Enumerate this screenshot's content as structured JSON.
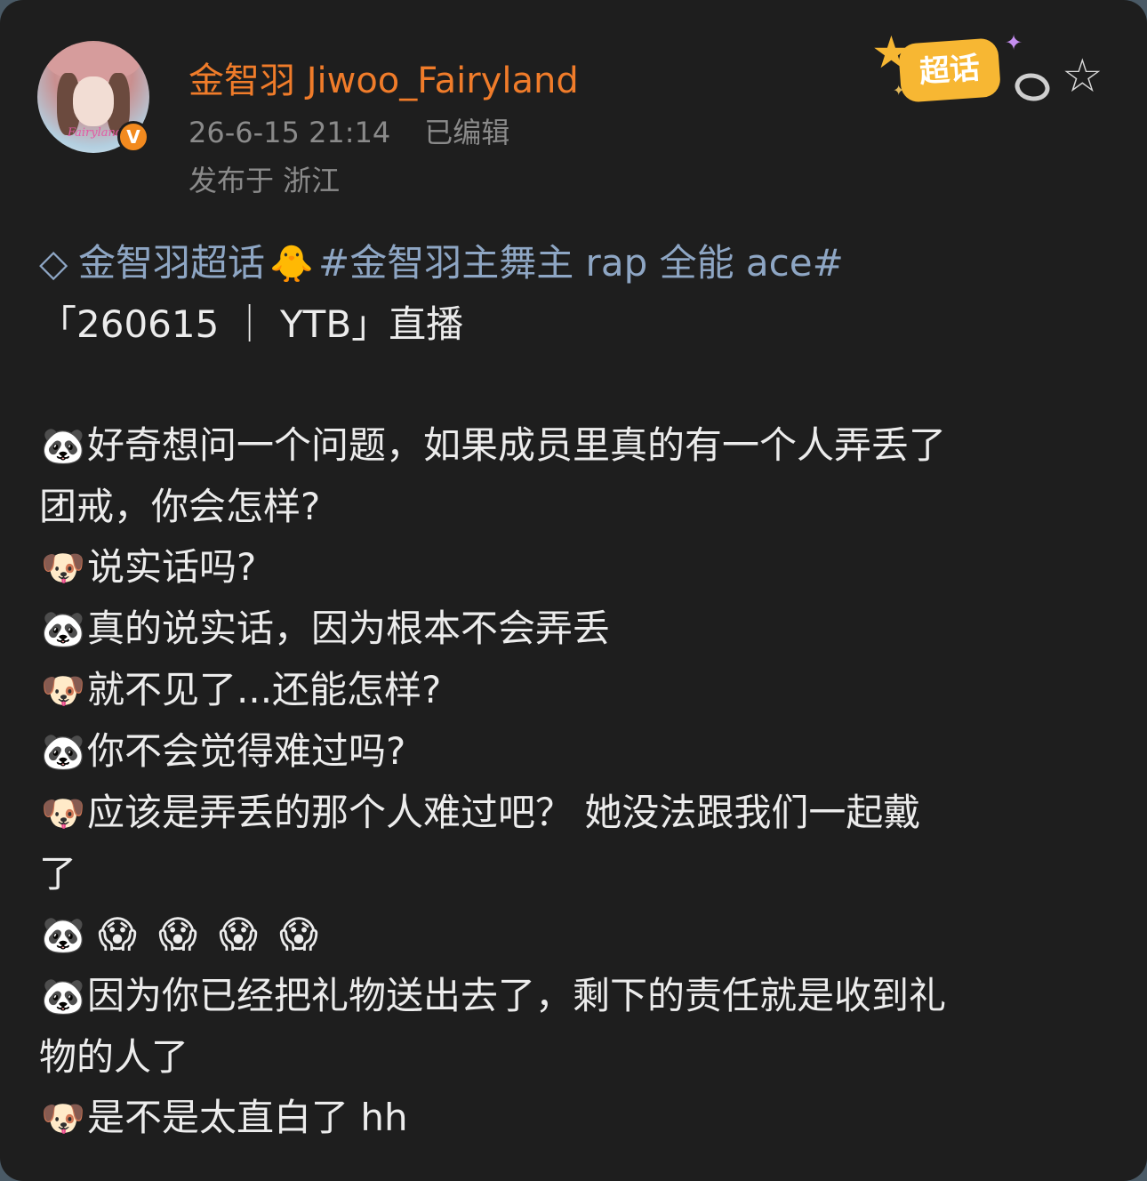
{
  "user": {
    "name": "金智羽 Jiwoo_Fairyland",
    "avatar_text": "Fairyland",
    "verified_badge": "V",
    "timestamp": "26-6-15 21:14",
    "edited": "已编辑",
    "location": "发布于 浙江"
  },
  "actions": {
    "supertopic_label": "超话",
    "favorite_icon": "star-icon",
    "supertopic_icon": "supertopic-icon"
  },
  "post": {
    "supertopic": "金智羽超话",
    "hashtag": "#金智羽主舞主 rap 全能 ace#",
    "header": "「260615 ｜ YTB」直播",
    "lines": [
      "好奇想问一个问题，如果成员里真的有一个人弄丢了",
      "团戒，你会怎样?",
      "说实话吗?",
      "真的说实话，因为根本不会弄丢",
      "就不见了...还能怎样?",
      "你不会觉得难过吗?",
      "应该是弄丢的那个人难过吧？ 她没法跟我们一起戴",
      "了",
      "因为你已经把礼物送出去了，剩下的责任就是收到礼",
      "物的人了",
      "是不是太直白了 hh"
    ],
    "emojis": {
      "panda": "🐼",
      "dog": "🐶",
      "chick": "🐥",
      "scream": "😱"
    }
  },
  "colors": {
    "background": "#1e1e1e",
    "username": "#f07c2a",
    "meta": "#8a8a8a",
    "topic": "#8ea6c4",
    "text": "#ececec",
    "badge": "#f7b733"
  }
}
